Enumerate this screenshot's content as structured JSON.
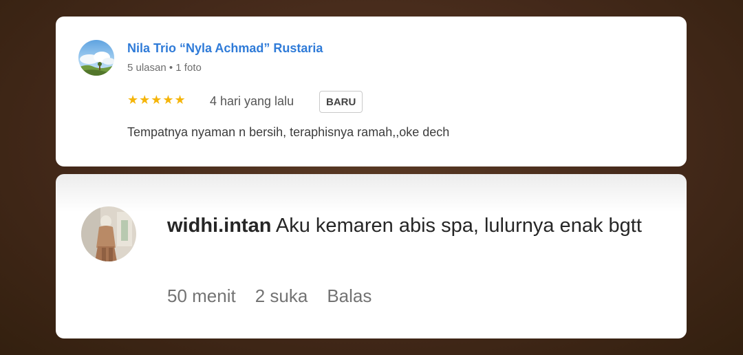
{
  "review": {
    "reviewer_name": "Nila Trio “Nyla Achmad” Rustaria",
    "reviewer_meta": "5 ulasan • 1 foto",
    "rating": 5,
    "stars": "★★★★★",
    "time": "4 hari yang lalu",
    "badge": "BARU",
    "text": "Tempatnya nyaman n bersih, teraphisnya ramah,,oke dech",
    "colors": {
      "name": "#2f7bd8",
      "stars": "#f5b50a"
    }
  },
  "comment": {
    "username": "widhi.intan",
    "text": "Aku kemaren abis spa, lulurnya enak bgtt",
    "time": "50 menit",
    "likes": "2 suka",
    "reply_label": "Balas"
  }
}
